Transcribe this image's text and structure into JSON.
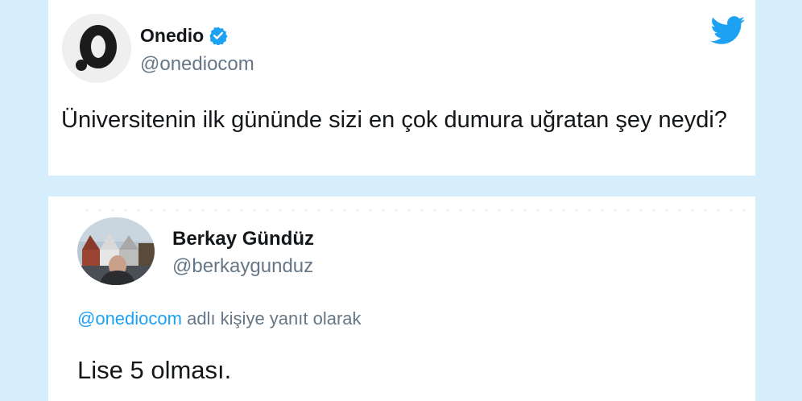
{
  "original_tweet": {
    "display_name": "Onedio",
    "handle": "@onediocom",
    "text": "Üniversitenin ilk gününde sizi en çok dumura uğratan şey neydi?",
    "verified": true,
    "avatar_icon": "onedio-logo-icon",
    "platform_icon": "twitter-bird-icon",
    "brand_color": "#1da1f2"
  },
  "reply_tweet": {
    "display_name": "Berkay Gündüz",
    "handle": "@berkaygunduz",
    "reply_to_handle": "@onediocom",
    "reply_to_suffix": " adlı kişiye yanıt olarak",
    "text": "Lise 5 olması.",
    "avatar_icon": "profile-photo-avatar"
  }
}
